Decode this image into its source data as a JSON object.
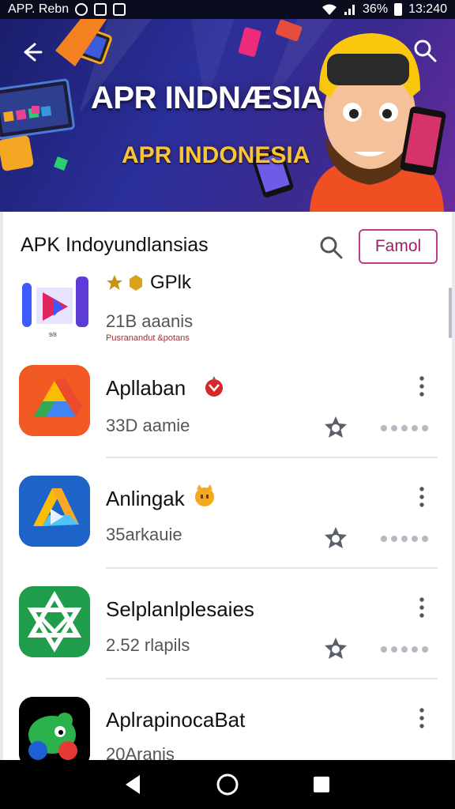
{
  "status_bar": {
    "left_text": "APP. Rebn",
    "battery": "36%",
    "time": "13:240",
    "icons": [
      "sync-icon",
      "alarm-icon",
      "notification-icon",
      "wifi-icon",
      "signal-icon",
      "battery-icon"
    ]
  },
  "banner": {
    "title": "APR INDNÆSIA",
    "subtitle": "APR INDONESIA",
    "back_icon": "arrow-left-icon",
    "search_icon": "search-icon"
  },
  "list_header": {
    "title": "APK Indoyundlansias",
    "search_icon": "search-icon",
    "filter_label": "Famol"
  },
  "apps": [
    {
      "name": "GPlk",
      "meta": "21B aaanis",
      "sub": "Pusranandut &potans",
      "badge_icons": [
        "star-icon",
        "gem-icon"
      ],
      "icon": "purple-play-icon"
    },
    {
      "name": "Apllaban",
      "meta": "33D aamie",
      "badge_icon": "red-fruit-icon",
      "icon": "google-drive-icon",
      "accent": "#f15a22"
    },
    {
      "name": "Anlingak",
      "meta": "35arkauie",
      "badge_icon": "yellow-cat-icon",
      "icon": "drive-triangle-icon",
      "accent": "#1e64c8"
    },
    {
      "name": "Selplanlplesaies",
      "meta": "2.52 rlapils",
      "icon": "green-star-icon",
      "accent": "#1f9d4b"
    },
    {
      "name": "AplrapinocaBat",
      "meta": "20Aranis",
      "icon": "green-monster-icon",
      "accent": "#000000"
    }
  ],
  "nav_bar": {
    "icons": [
      "back-triangle-icon",
      "home-circle-icon",
      "recents-square-icon"
    ]
  },
  "colors": {
    "banner_bg": "#2b2f9a",
    "filter_border": "#c33d86",
    "title_yellow": "#f8c53a"
  }
}
